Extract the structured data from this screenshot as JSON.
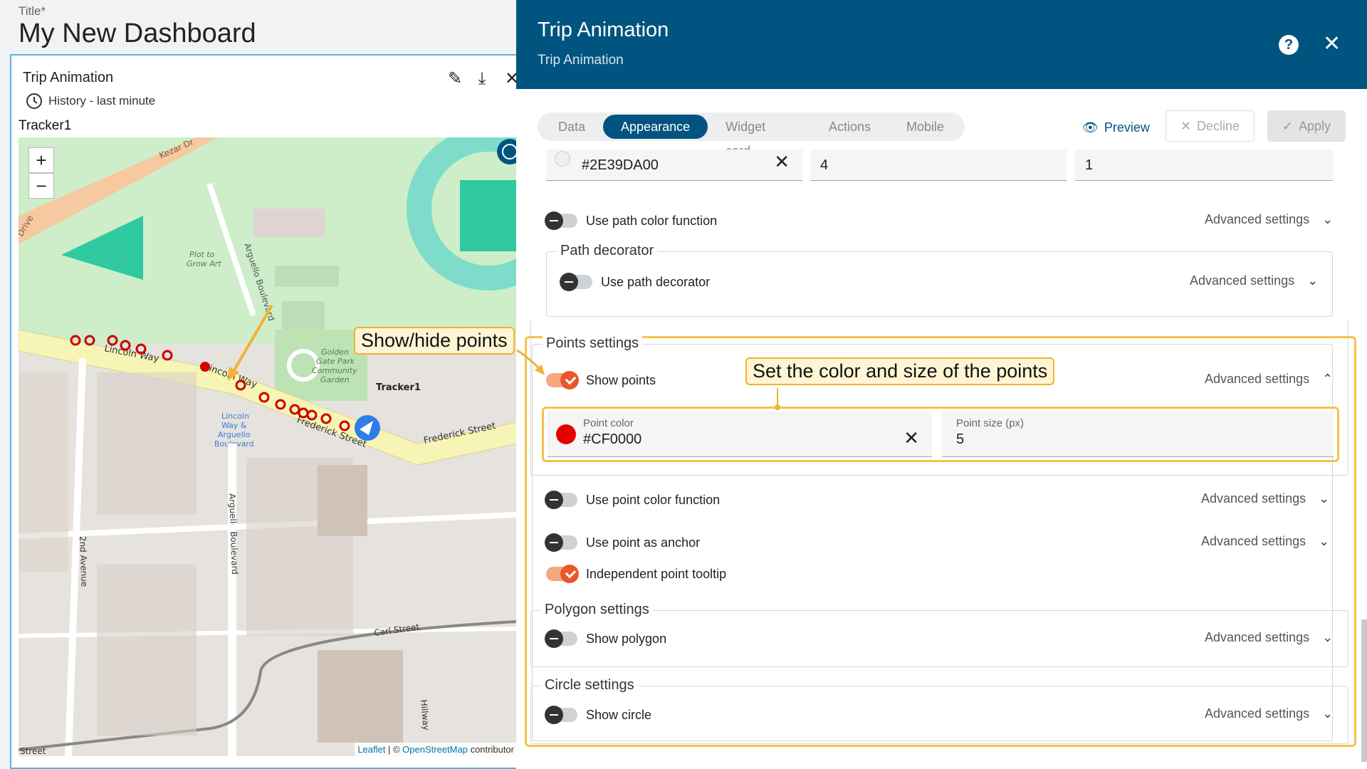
{
  "dashboard": {
    "title_label": "Title*",
    "title": "My New Dashboard",
    "widget": {
      "title": "Trip Animation",
      "history": "History - last minute",
      "tracker": "Tracker1",
      "icons": [
        "edit-icon",
        "download-icon",
        "close-icon",
        "clock-icon"
      ]
    },
    "map": {
      "zoom_in": "+",
      "zoom_out": "−",
      "attribution_leaflet": "Leaflet",
      "attribution_sep": " | © ",
      "attribution_osm": "OpenStreetMap",
      "attribution_rest": " contributor",
      "labels": {
        "kezar": "Kezar Dr",
        "drive": "Drive",
        "plot": "Plot to",
        "grow": "Grow Art",
        "arguello": "Arguello Boulevard",
        "arguello2": "Arguello Boulevard",
        "golden1": "Golden",
        "golden2": "Gate Park",
        "golden3": "Community",
        "golden4": "Garden",
        "tracker": "Tracker1",
        "lincoln": "Lincoln Way",
        "lincoln2": "Lincoln Way",
        "stop1": "Lincoln",
        "stop2": "Way &",
        "stop3": "Arguello",
        "stop4": "Boulevard",
        "frederick": "Frederick Street",
        "frederick2": "Frederick Street",
        "carl": "Carl Street",
        "second": "2nd Avenue",
        "hillway": "Hillway",
        "street": "Street"
      },
      "point_color": "#CF0000",
      "path_color": "#2E39DA"
    },
    "callout_points": "Show/hide points"
  },
  "panel": {
    "title": "Trip Animation",
    "subtitle": "Trip Animation",
    "tabs": [
      "Data",
      "Appearance",
      "Widget card",
      "Actions",
      "Mobile"
    ],
    "active_tab": "Appearance",
    "preview": "Preview",
    "decline": "Decline",
    "apply": "Apply",
    "path_row": {
      "color": "#2E39DA00",
      "width": "4",
      "opacity": "1"
    },
    "use_path_color_function": "Use path color function",
    "advanced": "Advanced settings",
    "path_decorator": {
      "title": "Path decorator",
      "use": "Use path decorator"
    },
    "points_settings": {
      "title": "Points settings",
      "show_points": "Show points",
      "callout": "Set the color and size of the points",
      "point_color_label": "Point color",
      "point_color": "#CF0000",
      "point_size_label": "Point size (px)",
      "point_size": "5",
      "use_point_color_function": "Use point color function",
      "use_point_as_anchor": "Use point as anchor",
      "independent_point_tooltip": "Independent point tooltip"
    },
    "polygon_settings": {
      "title": "Polygon settings",
      "show": "Show polygon"
    },
    "circle_settings": {
      "title": "Circle settings",
      "show": "Show circle"
    }
  }
}
